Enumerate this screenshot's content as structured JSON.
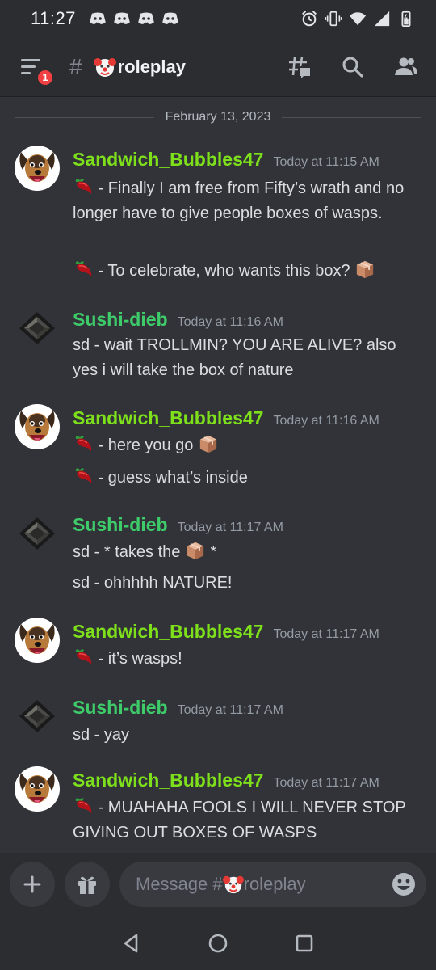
{
  "status_bar": {
    "time": "11:27"
  },
  "header": {
    "badge_count": "1",
    "hash": "#",
    "channel_emoji": "clown-face",
    "channel_name": "roleplay"
  },
  "date_divider": "February 13, 2023",
  "messages": [
    {
      "username": "Sandwich_Bubbles47",
      "timestamp": "Today at 11:15 AM",
      "lines": [
        {
          "prefix": "- ",
          "text": "Finally I am free from Fifty’s wrath and no longer have to give people boxes of wasps."
        },
        {
          "prefix": "- ",
          "text": "To celebrate, who wants this box?"
        }
      ]
    },
    {
      "username": "Sushi-dieb",
      "timestamp": "Today at 11:16 AM",
      "lines": [
        {
          "text": "sd - wait TROLLMIN? YOU ARE ALIVE? also yes i will take the box of nature"
        }
      ]
    },
    {
      "username": "Sandwich_Bubbles47",
      "timestamp": "Today at 11:16 AM",
      "lines": [
        {
          "prefix": "- ",
          "text": "here you go"
        },
        {
          "prefix": "- ",
          "text": "guess what’s inside"
        }
      ]
    },
    {
      "username": "Sushi-dieb",
      "timestamp": "Today at 11:17 AM",
      "lines": [
        {
          "text": "sd - * takes the",
          "suffix": " *"
        },
        {
          "text": "sd - ohhhhh NATURE!"
        }
      ]
    },
    {
      "username": "Sandwich_Bubbles47",
      "timestamp": "Today at 11:17 AM",
      "lines": [
        {
          "prefix": "- ",
          "text": "it’s wasps!"
        }
      ]
    },
    {
      "username": "Sushi-dieb",
      "timestamp": "Today at 11:17 AM",
      "lines": [
        {
          "text": "sd - yay"
        }
      ]
    },
    {
      "username": "Sandwich_Bubbles47",
      "timestamp": "Today at 11:17 AM",
      "lines": [
        {
          "prefix": "- ",
          "text": "MUAHAHA FOOLS I WILL NEVER STOP GIVING OUT BOXES OF WASPS"
        }
      ]
    }
  ],
  "input": {
    "placeholder_prefix": "Message #",
    "placeholder_channel": "roleplay"
  },
  "colors": {
    "background": "#313338",
    "header": "#2b2d31",
    "sandwich_name": "#7ee01b",
    "sushi_name": "#3ecb6a",
    "badge": "#f23f42"
  }
}
